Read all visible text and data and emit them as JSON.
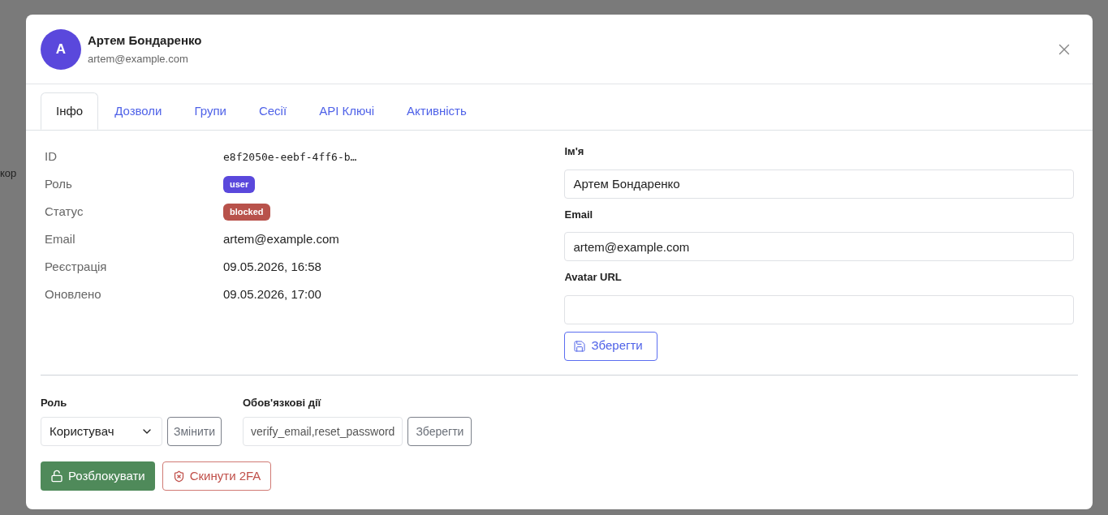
{
  "background_fragment": "кор",
  "header": {
    "avatar_letter": "A",
    "name": "Артем Бондаренко",
    "email": "artem@example.com"
  },
  "tabs": [
    {
      "label": "Інфо",
      "selected": true
    },
    {
      "label": "Дозволи",
      "selected": false
    },
    {
      "label": "Групи",
      "selected": false
    },
    {
      "label": "Сесії",
      "selected": false
    },
    {
      "label": "API Ключі",
      "selected": false
    },
    {
      "label": "Активність",
      "selected": false
    }
  ],
  "info_rows": [
    {
      "label": "ID",
      "kind": "mono",
      "value": "e8f2050e-eebf-4ff6-b…"
    },
    {
      "label": "Роль",
      "kind": "badge",
      "value": "user",
      "color": "#5a48dc"
    },
    {
      "label": "Статус",
      "kind": "badge",
      "value": "blocked",
      "color": "#b8524b"
    },
    {
      "label": "Email",
      "kind": "text",
      "value": "artem@example.com"
    },
    {
      "label": "Реєстрація",
      "kind": "text",
      "value": "09.05.2026, 16:58"
    },
    {
      "label": "Оновлено",
      "kind": "text",
      "value": "09.05.2026, 17:00"
    }
  ],
  "profile_form": {
    "fields": [
      {
        "label": "Ім'я",
        "value": "Артем Бондаренко"
      },
      {
        "label": "Email",
        "value": "artem@example.com"
      },
      {
        "label": "Avatar URL"
      }
    ],
    "save_button": "Зберегти"
  },
  "role_section": {
    "label": "Роль",
    "selected_role": "Користувач",
    "button": "Змінити"
  },
  "required_actions": {
    "label": "Обов'язкові дії",
    "value": "verify_email,reset_password",
    "button": "Зберегти"
  },
  "actions": [
    {
      "kind": "unlock",
      "label": "Розблокувати"
    },
    {
      "kind": "reset_2fa",
      "label": "Скинути 2FA"
    }
  ]
}
